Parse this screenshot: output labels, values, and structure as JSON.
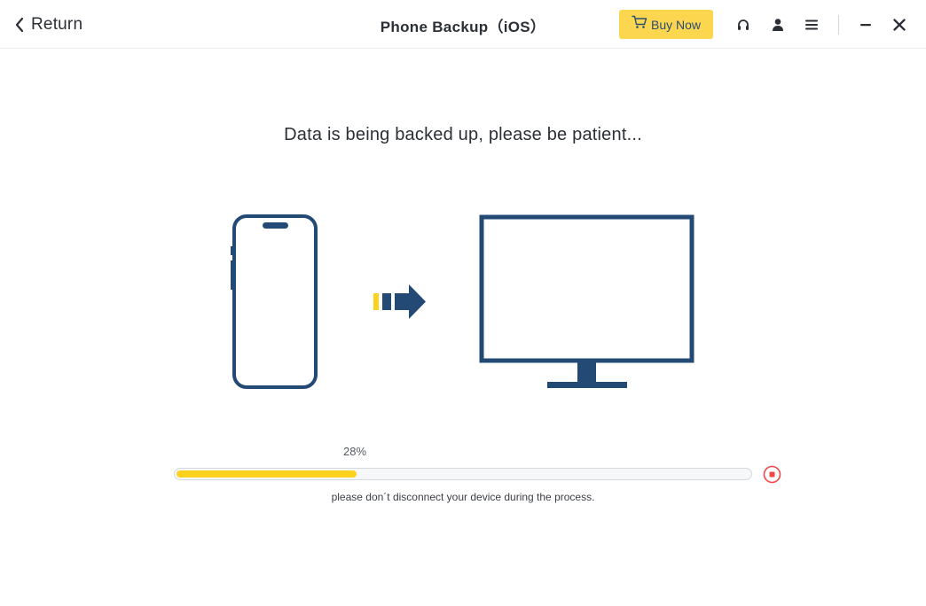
{
  "titlebar": {
    "return_label": "Return",
    "title": "Phone Backup（iOS）",
    "buy_label": "Buy Now",
    "icons": [
      "chevron-left-icon",
      "cart-icon",
      "headset-icon",
      "user-icon",
      "menu-icon",
      "minimize-icon",
      "close-icon"
    ]
  },
  "main": {
    "message": "Data is being backed up, please be patient...",
    "progress": {
      "value": 0.28,
      "label": "28%"
    },
    "notice": "please don´t disconnect your device during the process.",
    "stop_icon": "stop-icon"
  },
  "colors": {
    "accent_yellow": "#fcd64f",
    "progress_yellow": "#fcd21f",
    "illustration_navy": "#234a75",
    "stop_red": "#f04848",
    "text": "#2b2f36"
  }
}
